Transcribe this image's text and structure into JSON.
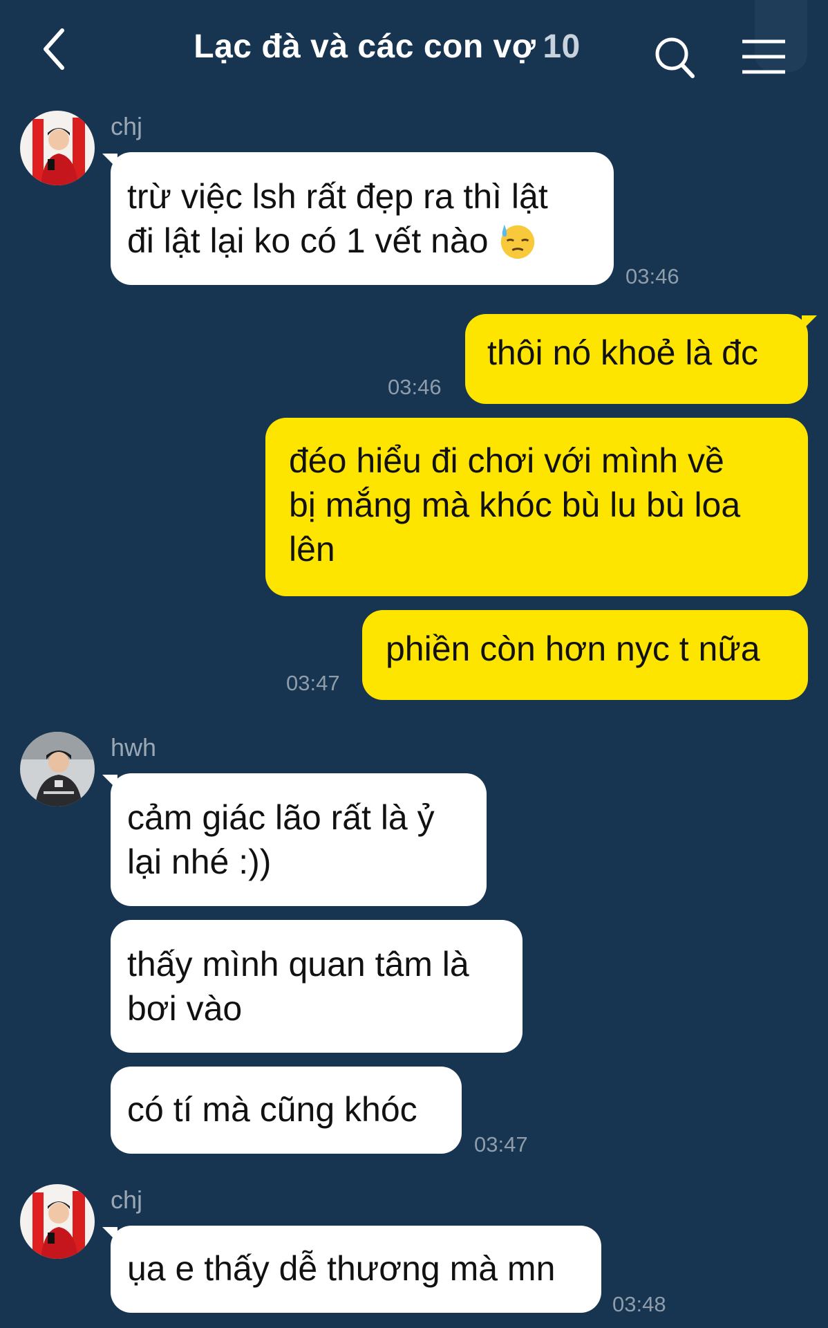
{
  "header": {
    "title": "Lạc đà và các con vợ",
    "member_count": "10",
    "back_icon": "chevron-left-icon",
    "search_icon": "search-icon",
    "menu_icon": "hamburger-menu-icon"
  },
  "messages": [
    {
      "sender": "chj",
      "lines": [
        "trừ việc lsh rất đẹp ra thì lật",
        "đi lật lại ko có 1 vết nào"
      ],
      "emoji": "downcast-face-with-sweat",
      "time": "03:46"
    },
    {
      "text": "thôi nó khoẻ là đc",
      "time": "03:46"
    },
    {
      "lines": [
        "đéo hiểu đi chơi với mình về",
        "bị mắng mà khóc bù lu bù loa",
        "lên"
      ]
    },
    {
      "text": "phiền còn hơn nyc t nữa",
      "time": "03:47"
    },
    {
      "sender": "hwh",
      "lines": [
        "cảm giác lão rất là ỷ",
        "lại nhé :))"
      ]
    },
    {
      "lines": [
        "thấy mình quan tâm là",
        "bơi vào"
      ]
    },
    {
      "text": "có tí mà cũng khóc",
      "time": "03:47"
    },
    {
      "sender": "chj",
      "text": "ụa e thấy dễ thương mà mn",
      "time": "03:48"
    }
  ],
  "colors": {
    "background": "#173550",
    "incoming_bubble": "#ffffff",
    "outgoing_bubble": "#fee500"
  }
}
